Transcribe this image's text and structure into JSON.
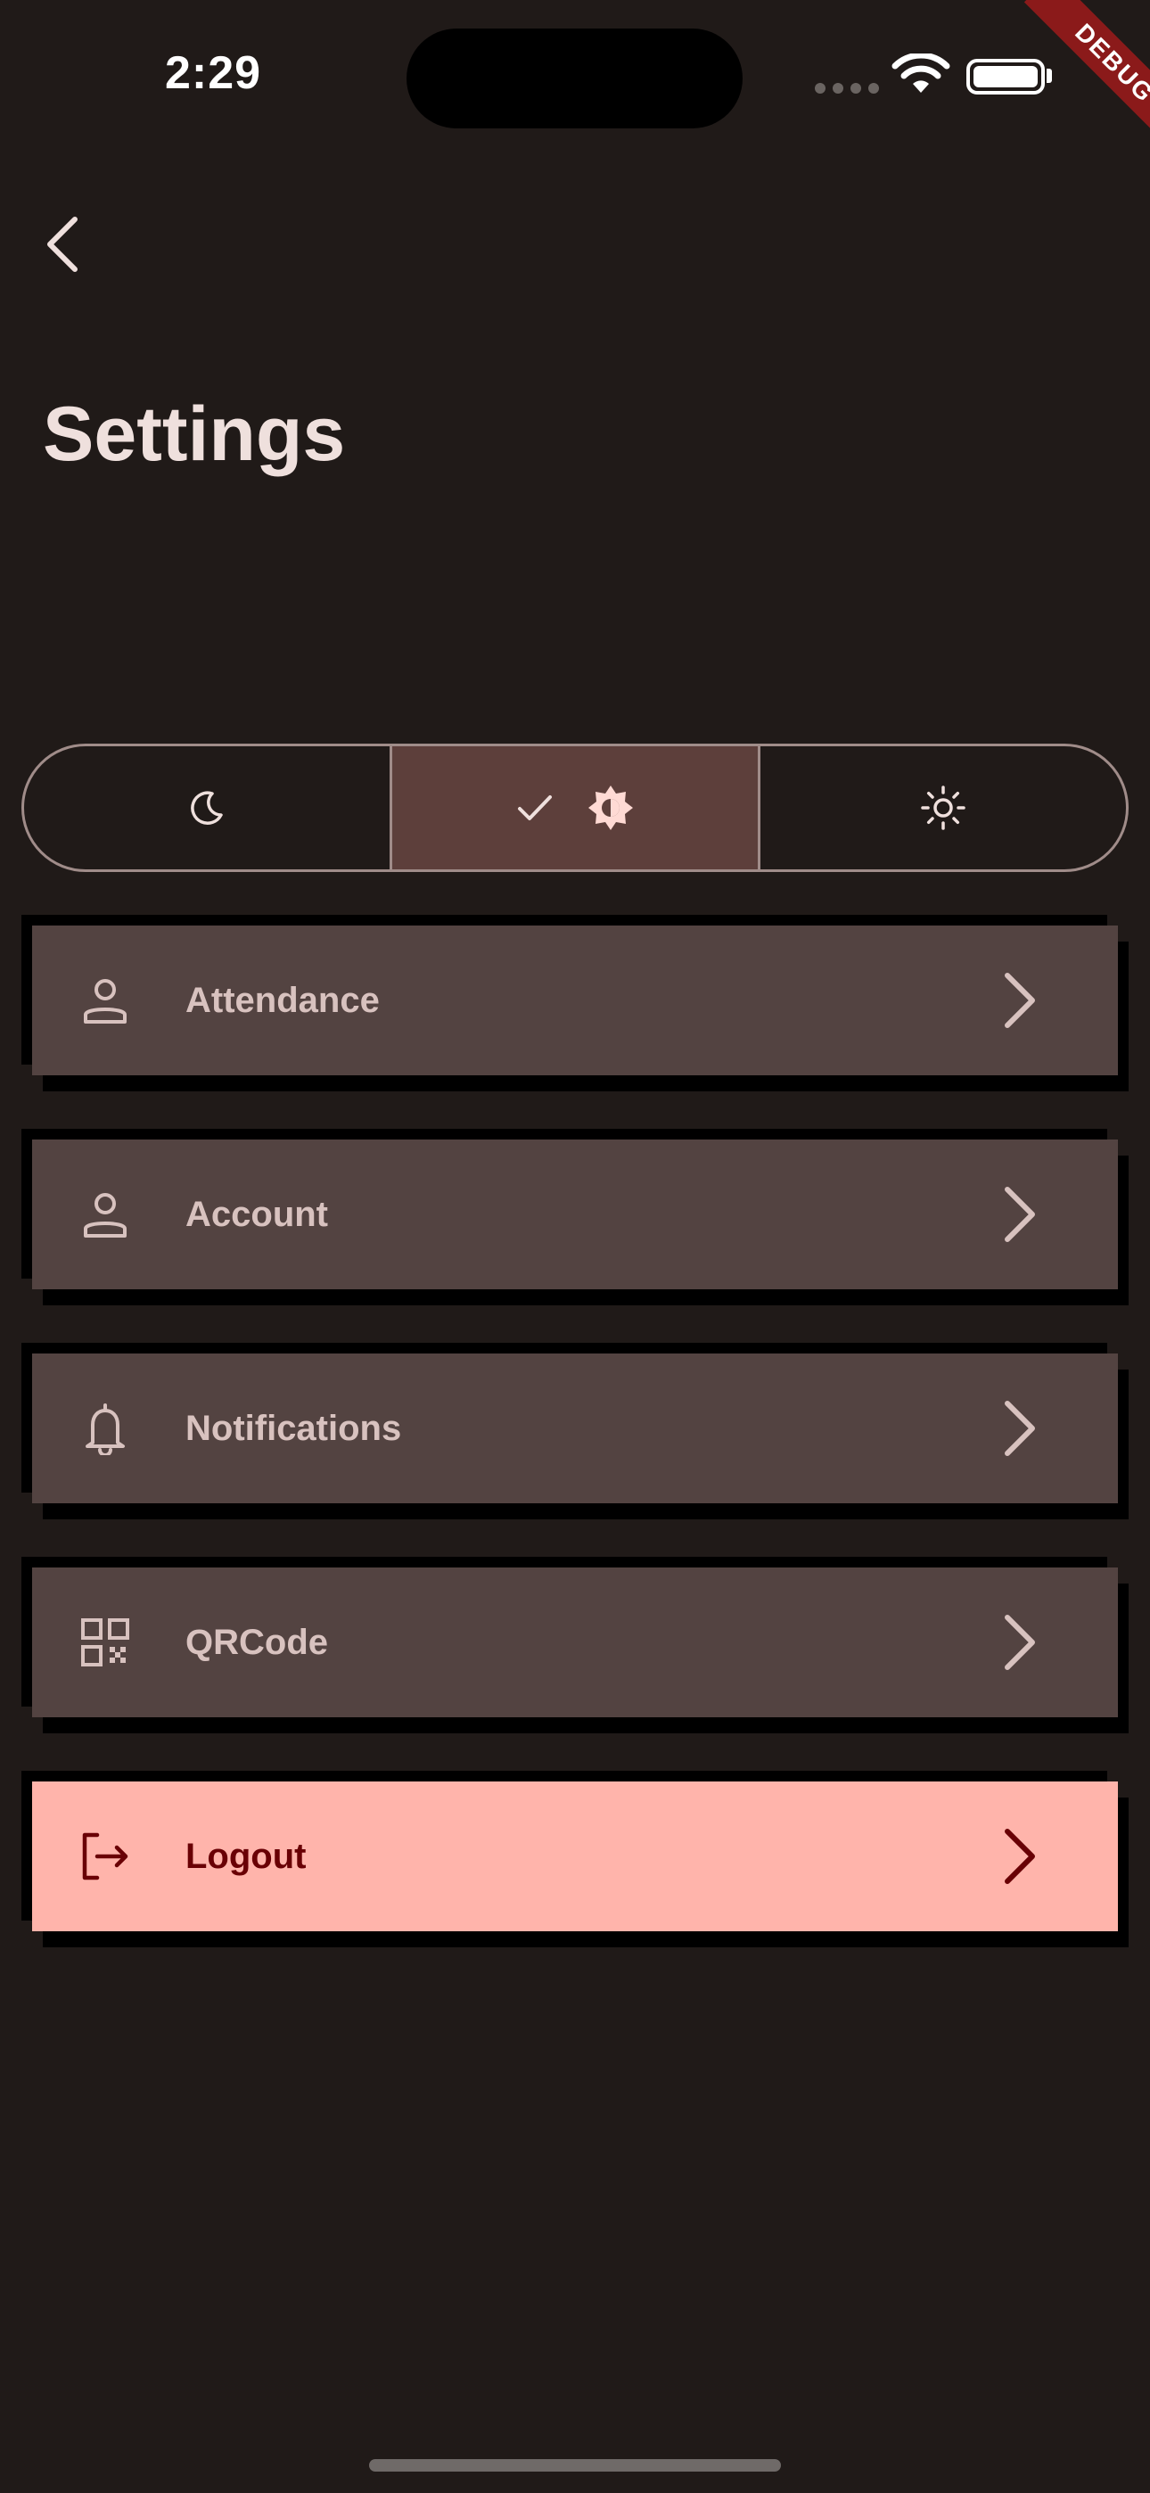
{
  "status_bar": {
    "time": "2:29"
  },
  "debug_banner": "DEBUG",
  "header": {
    "title": "Settings"
  },
  "theme_selector": {
    "options": [
      {
        "name": "dark",
        "icon": "moon-icon",
        "selected": false
      },
      {
        "name": "system",
        "icon": "brightness-auto-icon",
        "selected": true
      },
      {
        "name": "light",
        "icon": "sun-icon",
        "selected": false
      }
    ]
  },
  "menu": {
    "items": [
      {
        "label": "Attendance",
        "icon": "person-icon"
      },
      {
        "label": "Account",
        "icon": "person-icon"
      },
      {
        "label": "Notifications",
        "icon": "bell-icon"
      },
      {
        "label": "QRCode",
        "icon": "qr-code-icon"
      },
      {
        "label": "Logout",
        "icon": "logout-icon"
      }
    ]
  },
  "colors": {
    "background": "#201a18",
    "tile": "#534341",
    "tile_text": "#d8c2bf",
    "selected_segment": "#5d3f3b",
    "logout_bg": "#ffb4ab",
    "logout_text": "#690005"
  }
}
